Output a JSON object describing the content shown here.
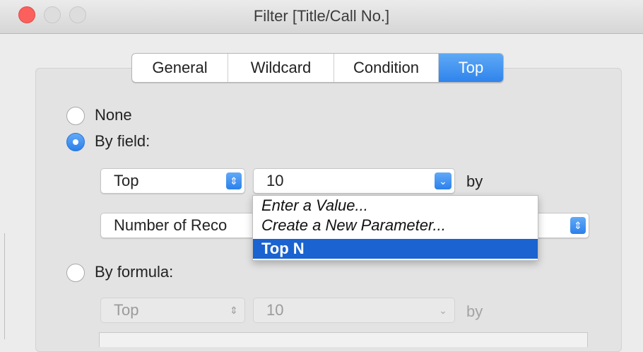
{
  "window": {
    "title": "Filter [Title/Call No.]"
  },
  "tabs": [
    {
      "label": "General",
      "active": false
    },
    {
      "label": "Wildcard",
      "active": false
    },
    {
      "label": "Condition",
      "active": false
    },
    {
      "label": "Top",
      "active": true
    }
  ],
  "options": {
    "none_label": "None",
    "by_field_label": "By field:",
    "by_formula_label": "By formula:",
    "selected": "By field:"
  },
  "by_field": {
    "direction_value": "Top",
    "count_value": "10",
    "by_label": "by",
    "field_value": "Number of Reco"
  },
  "dropdown": {
    "items": [
      "Enter a Value...",
      "Create a New Parameter...",
      "Top N"
    ],
    "highlighted": "Top N"
  },
  "by_formula": {
    "direction_value": "Top",
    "count_value": "10",
    "by_label": "by"
  },
  "colors": {
    "accent": "#2f84ec",
    "highlight": "#1a63d0",
    "close_button": "#fc605c"
  }
}
